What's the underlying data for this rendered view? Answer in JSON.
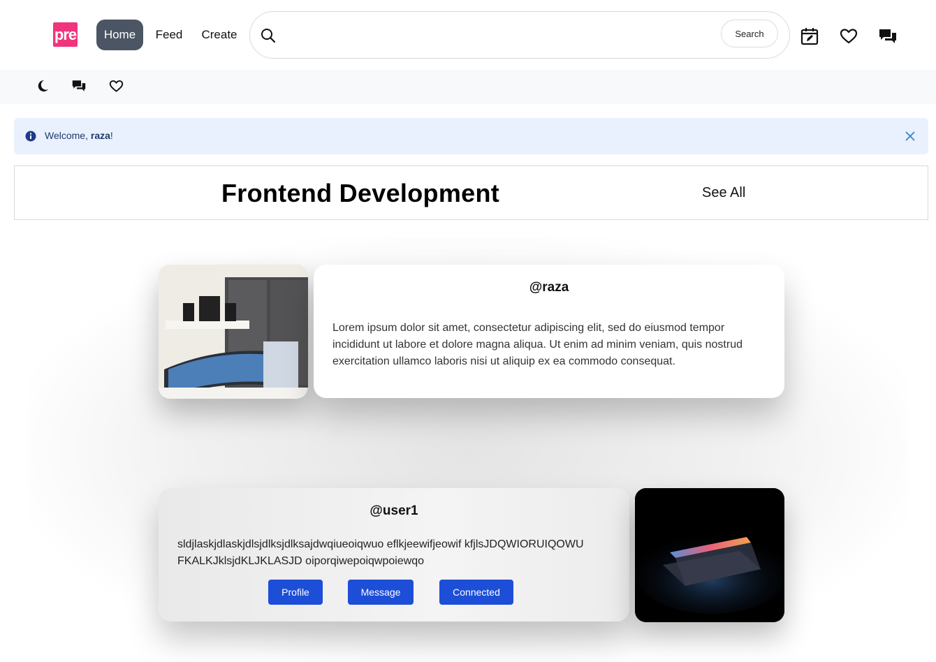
{
  "header": {
    "logo_text": "pre",
    "nav": [
      {
        "label": "Home",
        "active": true
      },
      {
        "label": "Feed",
        "active": false
      },
      {
        "label": "Create",
        "active": false
      }
    ],
    "search": {
      "placeholder": "",
      "button_label": "Search"
    },
    "icons": [
      "calendar-edit-icon",
      "heart-icon",
      "chat-icon"
    ]
  },
  "subbar": {
    "icons": [
      "moon-icon",
      "chat-icon",
      "heart-icon"
    ]
  },
  "alert": {
    "prefix": "Welcome, ",
    "username": "raza",
    "suffix": "!"
  },
  "section": {
    "title": "Frontend Development",
    "see_all": "See All"
  },
  "posts": [
    {
      "username": "@raza",
      "text": "Lorem ipsum dolor sit amet, consectetur adipiscing elit, sed do eiusmod tempor incididunt ut labore et dolore magna aliqua. Ut enim ad minim veniam, quis nostrud exercitation ullamco laboris nisi ut aliquip ex ea commodo consequat.",
      "image": "desk-setup-photo"
    },
    {
      "username": "@user1",
      "text": "sldjlaskjdlaskjdlsjdlksjdlksajdwqiueoiqwuo eflkjeewifjeowif kfjlsJDQWIORUIQOWU FKALKJklsjdKLJKLASJD oiporqiwepoiqwpoiewqo",
      "image": "laptop-photo",
      "buttons": {
        "profile": "Profile",
        "message": "Message",
        "connected": "Connected"
      }
    }
  ],
  "colors": {
    "accent": "#1d4ed8",
    "logo": "#f0357f",
    "nav_active": "#4b5563",
    "alert_bg": "#e8f1fd"
  }
}
